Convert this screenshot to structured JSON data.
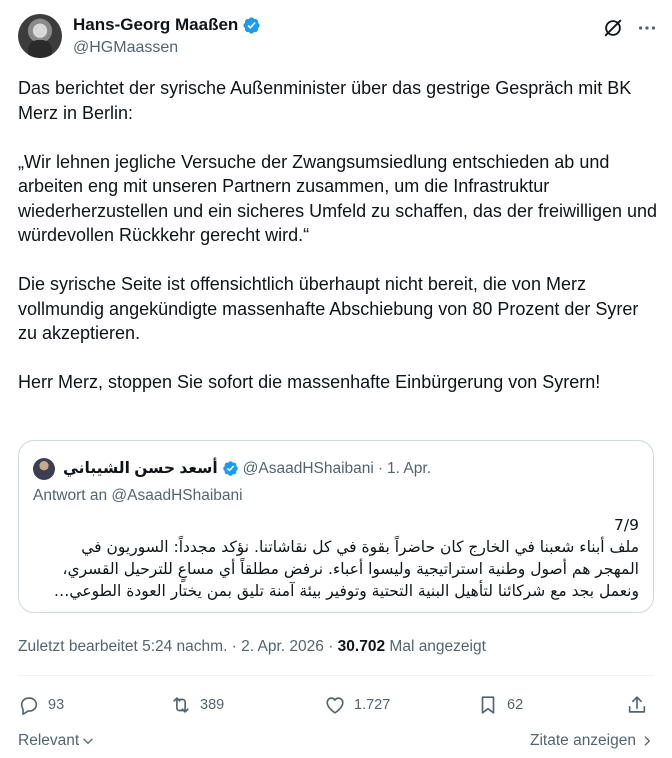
{
  "author": {
    "name": "Hans-Georg Maaßen",
    "handle": "@HGMaassen"
  },
  "tweet": {
    "paragraphs": [
      "Das berichtet der syrische Außenminister über das gestrige Gespräch mit BK Merz in Berlin:",
      "„Wir lehnen jegliche Versuche der Zwangsumsiedlung entschieden ab und arbeiten eng mit unseren Partnern zusammen, um die Infrastruktur wiederherzustellen und ein sicheres Umfeld zu schaffen, das der freiwilligen und würdevollen Rückkehr gerecht wird.“",
      "Die syrische Seite ist offensichtlich überhaupt nicht bereit, die von Merz vollmundig angekündigte massenhafte Abschiebung von 80 Prozent der Syrer zu akzeptieren.",
      "Herr Merz, stoppen Sie sofort die massenhafte Einbürgerung von Syrern!"
    ]
  },
  "quote": {
    "name": "أسعد حسن الشيباني",
    "handle": "@AsaadHShaibani",
    "date": "1. Apr.",
    "reply_to": "Antwort an @AsaadHShaibani",
    "counter": "7/9",
    "text": "ملف أبناء شعبنا في الخارج كان حاضراً بقوة في كل نقاشاتنا. نؤكد مجدداً: السوريون في المهجر هم أصول وطنية استراتيجية وليسوا أعباء. نرفض مطلقاً أي مساعٍ للترحيل القسري، ونعمل بجد مع شركائنا لتأهيل البنية التحتية وتوفير بيئة آمنة تليق بمن يختار العودة الطوعي…"
  },
  "meta": {
    "edited": "Zuletzt bearbeitet 5:24 nachm. · 2. Apr. 2026 ·",
    "views": "30.702",
    "views_label": "Mal angezeigt"
  },
  "actions": {
    "replies": "93",
    "reposts": "389",
    "likes": "1.727",
    "bookmarks": "62"
  },
  "footer": {
    "relevance": "Relevant",
    "quotes": "Zitate anzeigen"
  },
  "colors": {
    "verified": "#1d9bf0",
    "muted": "#536471",
    "border": "#cfd9de"
  }
}
